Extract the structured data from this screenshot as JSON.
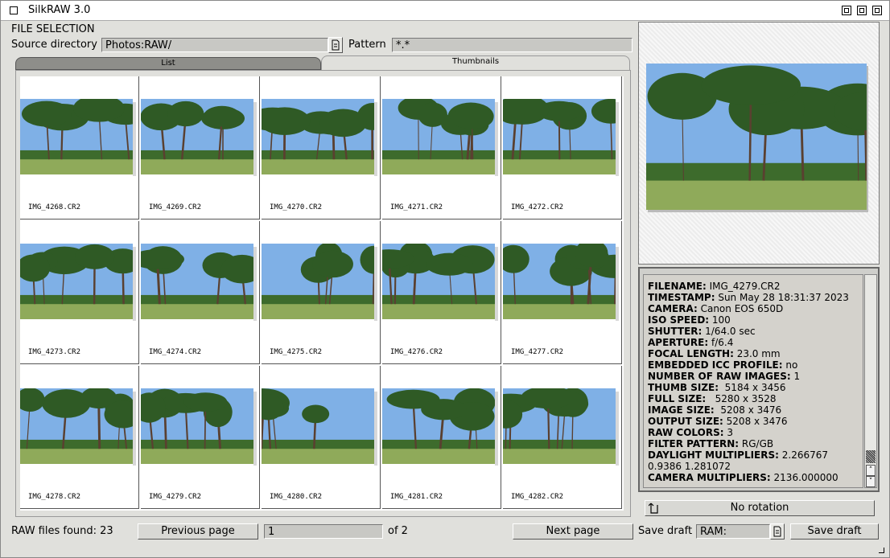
{
  "window": {
    "title": "SilkRAW 3.0"
  },
  "file_selection": {
    "section_title": "FILE SELECTION",
    "source_label": "Source directory",
    "source_value": "Photos:RAW/",
    "pattern_label": "Pattern",
    "pattern_value": "*.*"
  },
  "tabs": [
    {
      "label": "List",
      "active": false
    },
    {
      "label": "Thumbnails",
      "active": true
    }
  ],
  "thumbnails": [
    {
      "name": "IMG_4268.CR2"
    },
    {
      "name": "IMG_4269.CR2"
    },
    {
      "name": "IMG_4270.CR2"
    },
    {
      "name": "IMG_4271.CR2"
    },
    {
      "name": "IMG_4272.CR2"
    },
    {
      "name": "IMG_4273.CR2"
    },
    {
      "name": "IMG_4274.CR2"
    },
    {
      "name": "IMG_4275.CR2"
    },
    {
      "name": "IMG_4276.CR2"
    },
    {
      "name": "IMG_4277.CR2"
    },
    {
      "name": "IMG_4278.CR2"
    },
    {
      "name": "IMG_4279.CR2"
    },
    {
      "name": "IMG_4280.CR2"
    },
    {
      "name": "IMG_4281.CR2"
    },
    {
      "name": "IMG_4282.CR2"
    }
  ],
  "info": [
    {
      "key": "FILENAME:",
      "value": " IMG_4279.CR2"
    },
    {
      "key": "TIMESTAMP:",
      "value": " Sun May 28 18:31:37 2023"
    },
    {
      "key": "CAMERA:",
      "value": " Canon EOS 650D"
    },
    {
      "key": "ISO SPEED:",
      "value": " 100"
    },
    {
      "key": "SHUTTER:",
      "value": " 1/64.0 sec"
    },
    {
      "key": "APERTURE:",
      "value": " f/6.4"
    },
    {
      "key": "FOCAL LENGTH:",
      "value": " 23.0 mm"
    },
    {
      "key": "EMBEDDED ICC PROFILE:",
      "value": " no"
    },
    {
      "key": "NUMBER OF RAW IMAGES:",
      "value": " 1"
    },
    {
      "key": "THUMB SIZE:",
      "value": "  5184 x 3456"
    },
    {
      "key": "FULL SIZE:",
      "value": "   5280 x 3528"
    },
    {
      "key": "IMAGE SIZE:",
      "value": "  5208 x 3476"
    },
    {
      "key": "OUTPUT SIZE:",
      "value": " 5208 x 3476"
    },
    {
      "key": "RAW COLORS:",
      "value": " 3"
    },
    {
      "key": "FILTER PATTERN:",
      "value": " RG/GB"
    },
    {
      "key": "DAYLIGHT MULTIPLIERS:",
      "value": " 2.266767 0.9386 1.281072"
    },
    {
      "key": "CAMERA MULTIPLIERS:",
      "value": " 2136.000000"
    }
  ],
  "rotation": {
    "label": "No rotation"
  },
  "footer": {
    "raw_found": "RAW files found: 23",
    "prev_label": "Previous page",
    "page_value": "1",
    "page_of": "of 2",
    "next_label": "Next page",
    "save_draft_label": "Save draft",
    "save_draft_path": "RAM:",
    "save_draft_button": "Save draft"
  },
  "colors": {
    "sky": "#7fb0e6",
    "foliage": "#2f5a25",
    "grass": "#8faa5a",
    "trunk": "#5a4030"
  }
}
